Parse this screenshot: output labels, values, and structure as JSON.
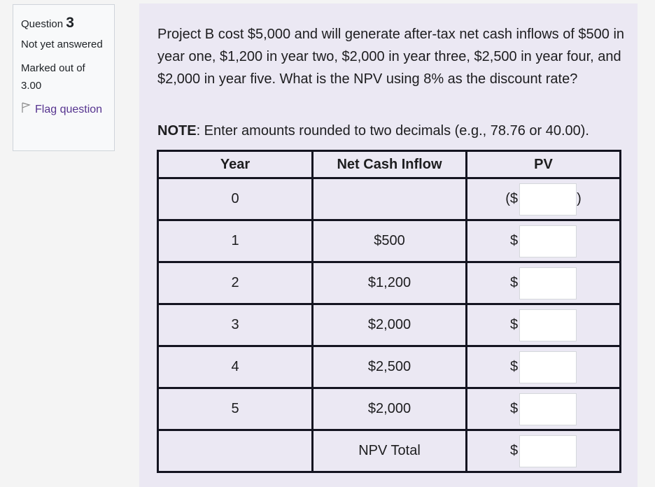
{
  "question_info": {
    "label": "Question",
    "number": "3",
    "state": "Not yet answered",
    "grade": "Marked out of 3.00",
    "flag_label": "Flag question",
    "flag_icon": "flag-icon"
  },
  "question": {
    "text": "Project B cost $5,000 and will generate after-tax net cash inflows of $500 in year one, $1,200 in year two, $2,000 in year three, $2,500 in year four, and $2,000 in year five. What is the NPV using 8% as the discount rate?",
    "note_label": "NOTE",
    "note_text": ": Enter amounts rounded to two decimals (e.g., 78.76 or 40.00)."
  },
  "table": {
    "headers": [
      "Year",
      "Net Cash Inflow",
      "PV"
    ],
    "rows": [
      {
        "year": "0",
        "inflow": "",
        "prefix": "($",
        "suffix": ")",
        "value": ""
      },
      {
        "year": "1",
        "inflow": "$500",
        "prefix": "$",
        "suffix": "",
        "value": ""
      },
      {
        "year": "2",
        "inflow": "$1,200",
        "prefix": "$",
        "suffix": "",
        "value": ""
      },
      {
        "year": "3",
        "inflow": "$2,000",
        "prefix": "$",
        "suffix": "",
        "value": ""
      },
      {
        "year": "4",
        "inflow": "$2,500",
        "prefix": "$",
        "suffix": "",
        "value": ""
      },
      {
        "year": "5",
        "inflow": "$2,000",
        "prefix": "$",
        "suffix": "",
        "value": ""
      },
      {
        "year": "",
        "inflow": "NPV Total",
        "prefix": "$",
        "suffix": "",
        "value": ""
      }
    ]
  },
  "colors": {
    "content_bg": "#ebe8f3",
    "link": "#56348f",
    "border": "#141420"
  }
}
